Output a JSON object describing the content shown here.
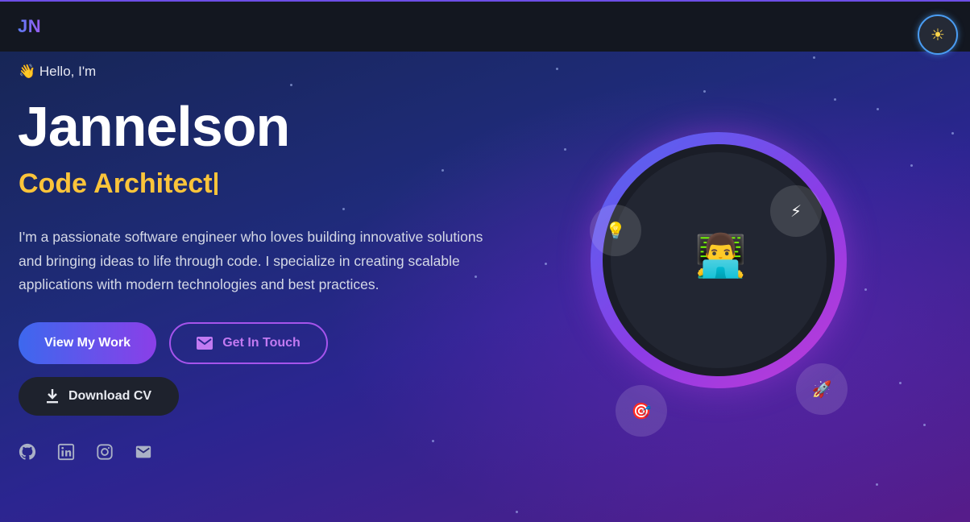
{
  "nav": {
    "logo": "JN",
    "theme_toggle_icon": "sun-icon"
  },
  "hero": {
    "greeting_emoji": "👋",
    "greeting": "Hello, I'm",
    "name": "Jannelson",
    "role": "Code Architect",
    "bio": "I'm a passionate software engineer who loves building innovative solutions and bringing ideas to life through code. I specialize in creating scalable applications with modern technologies and best practices.",
    "buttons": {
      "view_work": "View My Work",
      "get_in_touch": "Get In Touch",
      "download_cv": "Download CV"
    },
    "socials": [
      {
        "icon": "github-icon"
      },
      {
        "icon": "linkedin-icon"
      },
      {
        "icon": "instagram-icon"
      },
      {
        "icon": "email-icon"
      }
    ]
  },
  "visual": {
    "avatar": "👨‍💻",
    "bubbles": {
      "top_left": "💡",
      "top_right": "⚡",
      "bottom_left": "🎯",
      "bottom_right": "🚀"
    }
  },
  "colors": {
    "accent_yellow": "#fbc43a",
    "accent_purple": "#a654ec",
    "accent_blue": "#3d68ee"
  }
}
